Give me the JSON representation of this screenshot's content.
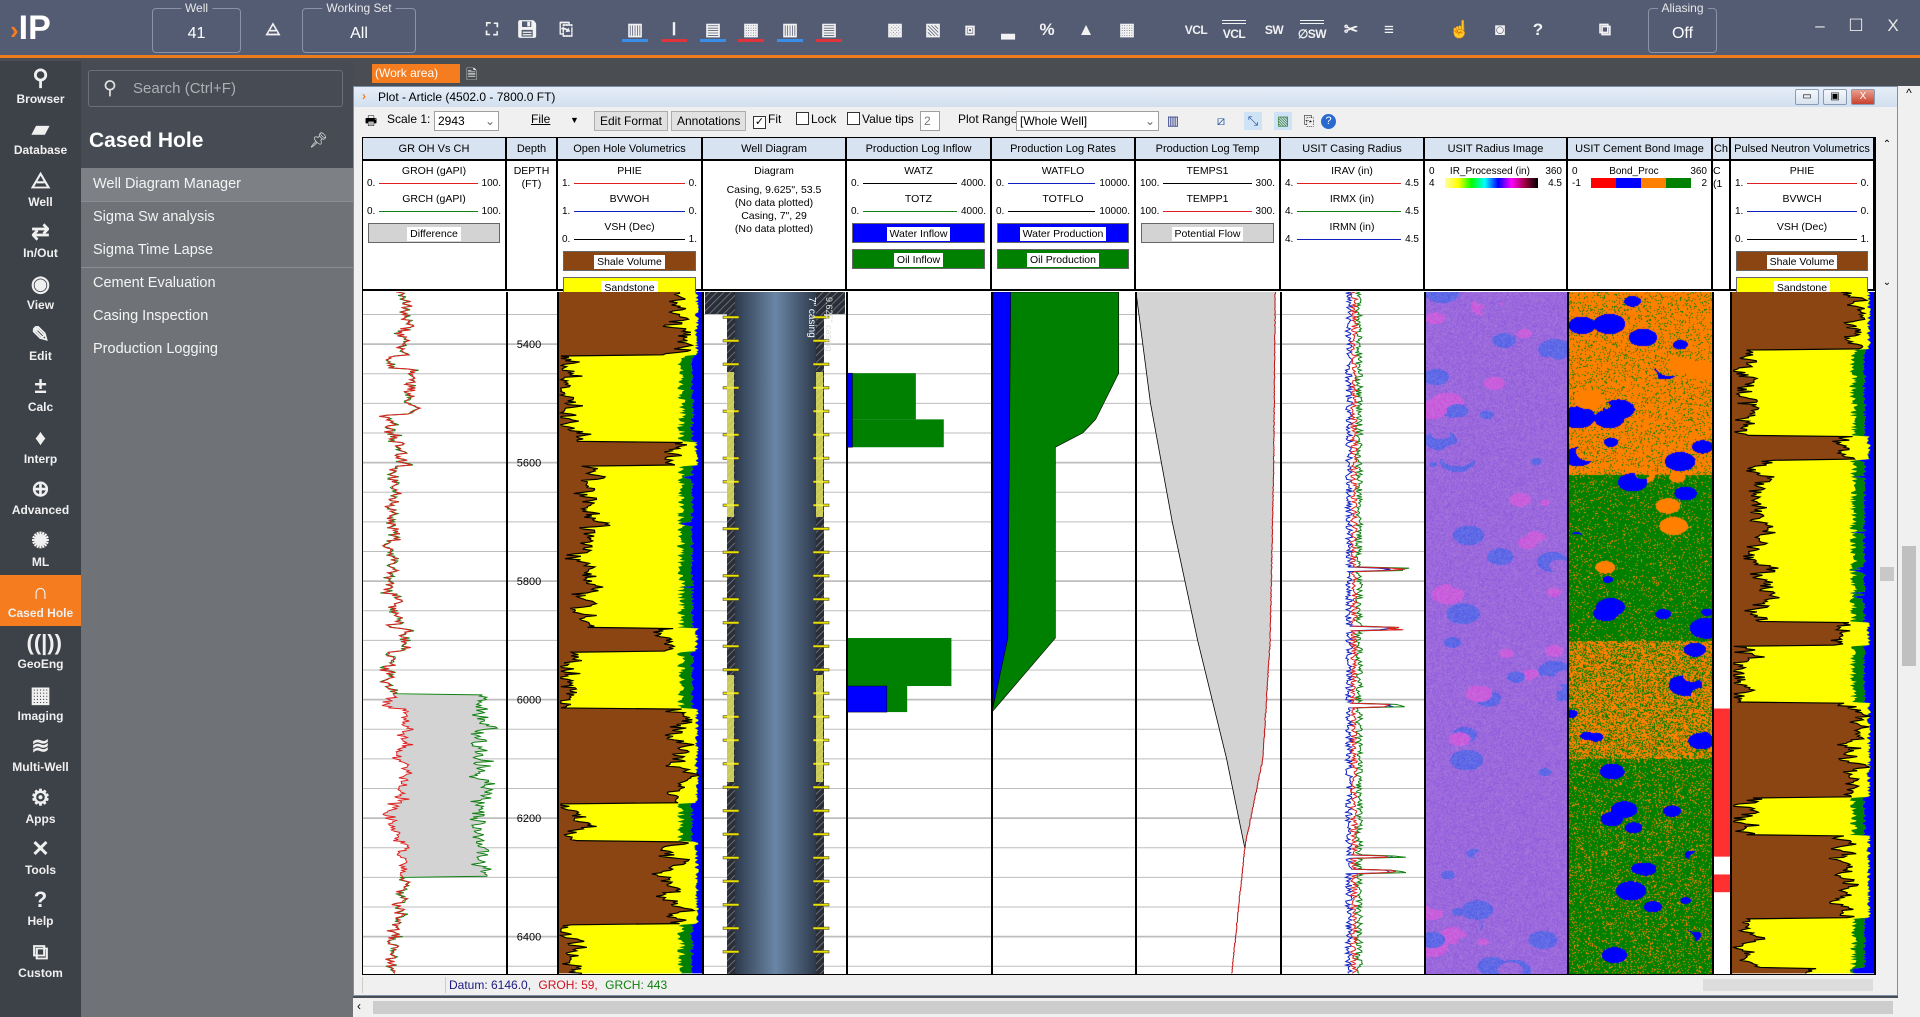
{
  "app": {
    "logo": "IP",
    "well": {
      "label": "Well",
      "value": "41"
    },
    "working_set": {
      "label": "Working Set",
      "value": "All"
    },
    "aliasing": {
      "label": "Aliasing",
      "value": "Off"
    },
    "toolbar_icons": [
      "map-pin-icon",
      "save-icon",
      "save-all-icon",
      "track-a-blue-icon",
      "track-aaa-red-icon",
      "track-image-a-blue-icon",
      "track-grid-aaa-red-icon",
      "track-multi-a-blue-icon",
      "track-table-aaa-red-icon",
      "crossplot-icon",
      "histogram-lines-icon",
      "multi-well-icon",
      "histogram-icon",
      "percent-crossplot-icon",
      "ternary-icon",
      "table-grid-icon",
      "vcl-icon",
      "vcl-multi-icon",
      "sw-icon",
      "phi-sw-multi-icon",
      "cutoff-icon",
      "cutoff-multi-icon",
      "pointer-icon",
      "screenshot-icon",
      "help-icon",
      "workflow-icon"
    ],
    "text_icons": {
      "vcl": "VCL",
      "vcl_multi": "VCL",
      "sw": "SW",
      "phi_sw": "∅SW"
    }
  },
  "rail": [
    {
      "label": "Browser",
      "icon": "browser-icon",
      "glyph": "⚲"
    },
    {
      "label": "Database",
      "icon": "folder-icon",
      "glyph": "▰"
    },
    {
      "label": "Well",
      "icon": "well-derrick-icon",
      "glyph": "⨺"
    },
    {
      "label": "In/Out",
      "icon": "import-export-icon",
      "glyph": "⇄"
    },
    {
      "label": "View",
      "icon": "eye-icon",
      "glyph": "◉"
    },
    {
      "label": "Edit",
      "icon": "edit-icon",
      "glyph": "✎"
    },
    {
      "label": "Calc",
      "icon": "calculator-icon",
      "glyph": "±"
    },
    {
      "label": "Interp",
      "icon": "droplet-icon",
      "glyph": "♦"
    },
    {
      "label": "Advanced",
      "icon": "droplet-plus-icon",
      "glyph": "⊕"
    },
    {
      "label": "ML",
      "icon": "brain-icon",
      "glyph": "✺"
    },
    {
      "label": "Cased Hole",
      "icon": "cased-hole-icon",
      "glyph": "∩",
      "active": true
    },
    {
      "label": "GeoEng",
      "icon": "geoeng-icon",
      "glyph": "((|))"
    },
    {
      "label": "Imaging",
      "icon": "imaging-icon",
      "glyph": "▦"
    },
    {
      "label": "Multi-Well",
      "icon": "multi-well-icon",
      "glyph": "≋"
    },
    {
      "label": "Apps",
      "icon": "apps-gear-icon",
      "glyph": "⚙"
    },
    {
      "label": "Tools",
      "icon": "tools-icon",
      "glyph": "✕"
    },
    {
      "label": "Help",
      "icon": "help-icon",
      "glyph": "?"
    },
    {
      "label": "Custom",
      "icon": "custom-icon",
      "glyph": "⧉"
    }
  ],
  "panel": {
    "search_placeholder": "Search (Ctrl+F)",
    "title": "Cased Hole",
    "items": [
      "Well Diagram Manager",
      "Sigma Sw analysis",
      "Sigma Time Lapse",
      "Cement Evaluation",
      "Casing Inspection",
      "Production Logging"
    ]
  },
  "tabs": {
    "work_area": "(Work area)"
  },
  "plot_window": {
    "title": "Plot - Article (4502.0 - 7800.0 FT)",
    "scale_label": "Scale 1:",
    "scale_value": "2943",
    "file_label": "File",
    "edit_format": "Edit Format",
    "annotations": "Annotations",
    "fit_label": "Fit",
    "fit_checked": true,
    "lock_label": "Lock",
    "lock_checked": false,
    "value_tips_label": "Value tips",
    "value_tips_checked": false,
    "value_tips_count": "2",
    "plot_range_label": "Plot Range",
    "plot_range_value": "[Whole Well]"
  },
  "tracks": [
    {
      "title": "GR OH Vs CH",
      "curves": [
        {
          "name": "GROH (gAPI)",
          "left": "0.",
          "right": "100.",
          "color": "#e02020"
        },
        {
          "name": "GRCH (gAPI)",
          "left": "0.",
          "right": "100.",
          "color": "#108010"
        }
      ],
      "fills": [
        {
          "label": "Difference",
          "color": "#d3d3d3"
        }
      ]
    },
    {
      "title": "Depth",
      "plain": [
        "DEPTH",
        "(FT)"
      ]
    },
    {
      "title": "Open Hole Volumetrics",
      "curves": [
        {
          "name": "PHIE",
          "left": "1.",
          "right": "0.",
          "color": "#e02020"
        },
        {
          "name": "BVWOH",
          "left": "1.",
          "right": "0.",
          "color": "#1020c0"
        },
        {
          "name": "VSH (Dec)",
          "left": "0.",
          "right": "1.",
          "color": "#000000"
        }
      ],
      "fills": [
        {
          "label": "Shale Volume",
          "color": "#8b4513"
        },
        {
          "label": "Sandstone",
          "color": "#ffff00"
        }
      ]
    },
    {
      "title": "Well Diagram",
      "plain": [
        "Diagram",
        "",
        "Casing, 9.625\", 53.5",
        "(No data plotted)",
        "Casing, 7\", 29",
        "(No data plotted)"
      ]
    },
    {
      "title": "Production Log Inflow",
      "curves": [
        {
          "name": "WATZ",
          "left": "0.",
          "right": "4000.",
          "color": "#000000"
        },
        {
          "name": "TOTZ",
          "left": "0.",
          "right": "4000.",
          "color": "#108010"
        }
      ],
      "fills": [
        {
          "label": "Water Inflow",
          "color": "#0000ff"
        },
        {
          "label": "Oil Inflow",
          "color": "#008000"
        }
      ]
    },
    {
      "title": "Production Log Rates",
      "curves": [
        {
          "name": "WATFLO",
          "left": "0.",
          "right": "10000.",
          "color": "#1020c0"
        },
        {
          "name": "TOTFLO",
          "left": "0.",
          "right": "10000.",
          "color": "#000000"
        }
      ],
      "fills": [
        {
          "label": "Water Production",
          "color": "#0000ff"
        },
        {
          "label": "Oil Production",
          "color": "#008000"
        }
      ]
    },
    {
      "title": "Production Log Temp",
      "curves": [
        {
          "name": "TEMPS1",
          "left": "100.",
          "right": "300.",
          "color": "#000000"
        },
        {
          "name": "TEMPP1",
          "left": "100.",
          "right": "300.",
          "color": "#e02020"
        }
      ],
      "fills": [
        {
          "label": "Potential Flow",
          "color": "#d3d3d3"
        }
      ]
    },
    {
      "title": "USIT Casing Radius",
      "curves": [
        {
          "name": "IRAV (in)",
          "left": "4.",
          "right": "4.5",
          "color": "#e02020"
        },
        {
          "name": "IRMX (in)",
          "left": "4.",
          "right": "4.5",
          "color": "#108010"
        },
        {
          "name": "IRMN (in)",
          "left": "4.",
          "right": "4.5",
          "color": "#1020c0"
        }
      ],
      "fills": []
    },
    {
      "title": "USIT Radius Image",
      "image": {
        "name": "IR_Processed (in)",
        "min": "0",
        "max": "360",
        "lo": "4",
        "hi": "4.5",
        "colors": [
          "#ffffa0",
          "#ffff00",
          "#00ff00",
          "#00ffff",
          "#0000ff",
          "#ff00ff",
          "#a00040",
          "#000000"
        ]
      }
    },
    {
      "title": "USIT Cement Bond Image",
      "image": {
        "name": "Bond_Proc",
        "min": "0",
        "max": "360",
        "lo": "-1",
        "hi": "2",
        "swatches": [
          "#ff0000",
          "#0000ff",
          "#ff8000",
          "#008000"
        ]
      }
    },
    {
      "title": "Ch",
      "plain": [
        "C",
        "(1"
      ]
    },
    {
      "title": "Pulsed Neutron Volumetrics",
      "curves": [
        {
          "name": "PHIE",
          "left": "1.",
          "right": "0.",
          "color": "#e02020"
        },
        {
          "name": "BVWCH",
          "left": "1.",
          "right": "0.",
          "color": "#1020c0"
        },
        {
          "name": "VSH (Dec)",
          "left": "0.",
          "right": "1.",
          "color": "#000000"
        }
      ],
      "fills": [
        {
          "label": "Shale Volume",
          "color": "#8b4513"
        },
        {
          "label": "Sandstone",
          "color": "#ffff00"
        }
      ]
    }
  ],
  "log_data": {
    "depth_range_ft": [
      5312,
      6463
    ],
    "depth_labels": [
      5400,
      5600,
      5800,
      6000,
      6200,
      6400
    ],
    "casing_labels": [
      "7\" casing",
      "9.625\" casing"
    ],
    "inflow": {
      "oil": [
        [
          5449,
          5527,
          1900
        ],
        [
          5527,
          5574,
          2670
        ],
        [
          5896,
          5977,
          2880
        ],
        [
          5977,
          6021,
          1660
        ]
      ],
      "water": [
        [
          5449,
          5574,
          150
        ],
        [
          5977,
          6021,
          1100
        ]
      ]
    },
    "rates": {
      "oil_depth": [
        5312,
        5449,
        5527,
        5550,
        5574,
        5896,
        6021
      ],
      "oil_value": [
        8800,
        8800,
        7200,
        6300,
        4400,
        4400,
        0
      ],
      "water_depth": [
        5312,
        5600,
        5896,
        6021
      ],
      "water_value": [
        1300,
        1200,
        1100,
        0
      ]
    },
    "temp": {
      "static_depth": [
        5312,
        5500,
        5700,
        5900,
        6100,
        6250
      ],
      "static_value": [
        100,
        120,
        150,
        185,
        225,
        250
      ],
      "flow_depth": [
        5312,
        5600,
        5900,
        6100,
        6250,
        6463
      ],
      "flow_value": [
        292,
        290,
        285,
        275,
        250,
        232
      ]
    },
    "lithology_zones": [
      [
        5312,
        5420,
        0.85
      ],
      [
        5420,
        5565,
        0.1
      ],
      [
        5565,
        5605,
        0.8
      ],
      [
        5605,
        5880,
        0.2
      ],
      [
        5880,
        5920,
        0.75
      ],
      [
        5920,
        6015,
        0.08
      ],
      [
        6015,
        6175,
        0.85
      ],
      [
        6175,
        6240,
        0.1
      ],
      [
        6240,
        6380,
        0.8
      ],
      [
        6380,
        6463,
        0.1
      ]
    ],
    "gr_difference_zone": [
      5990,
      6300
    ],
    "ch_flags": [
      [
        6015,
        6265
      ],
      [
        6295,
        6325
      ]
    ],
    "status": {
      "datum": "Datum: 6146.0,",
      "groh": "GROH: 59,",
      "grch": "GRCH: 443"
    }
  },
  "colors": {
    "accent": "#f57c1f",
    "topbar": "#545c74",
    "shale": "#8b4513",
    "sand": "#ffff00",
    "water": "#0000ff",
    "oil": "#008000"
  }
}
